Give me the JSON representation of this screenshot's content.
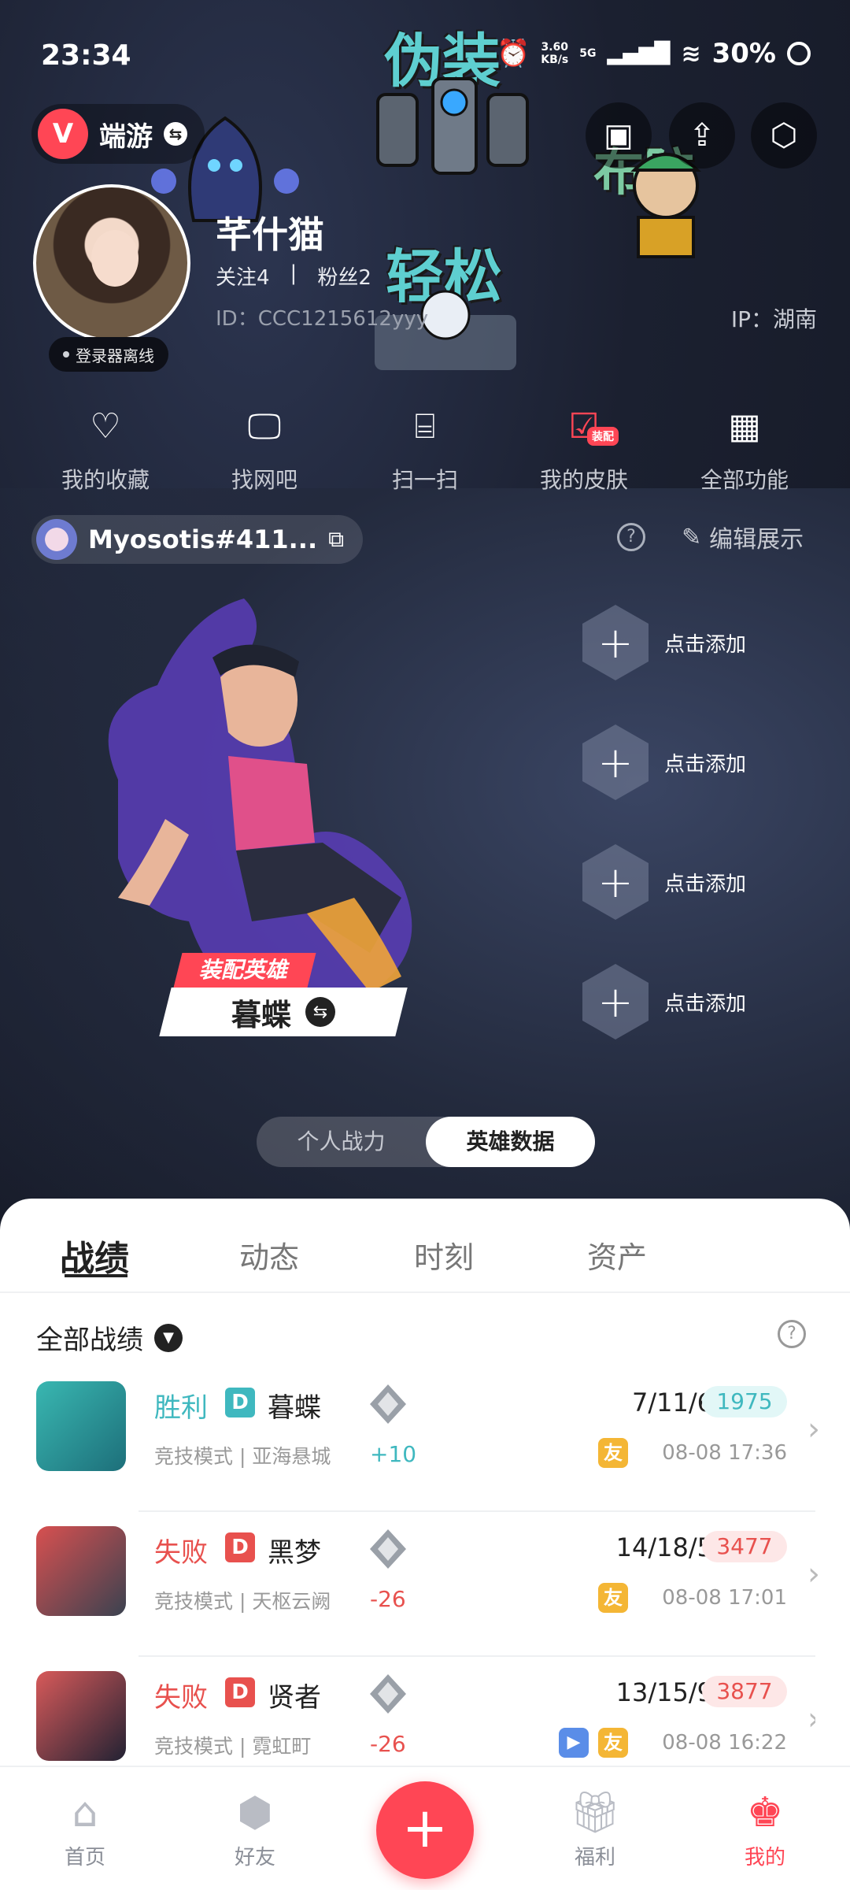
{
  "status_bar": {
    "time": "23:34",
    "net_speed_value": "3.60",
    "net_speed_unit": "KB/s",
    "network": "5G",
    "battery": "30%"
  },
  "stickers": {
    "top_text": "伪装",
    "middle_text": "轻松",
    "right_text": "布防"
  },
  "header": {
    "brand_name": "端游",
    "brand_logo_letter": "V"
  },
  "profile": {
    "username": "芊什猫",
    "follow": "关注4",
    "separator": "|",
    "fans": "粉丝2",
    "id": "ID：CCC1215612yyy",
    "ip": "IP：湖南",
    "status": "登录器离线"
  },
  "quick_actions": [
    {
      "label": "我的收藏",
      "icon": "heart-icon"
    },
    {
      "label": "找网吧",
      "icon": "monitor-icon"
    },
    {
      "label": "扫一扫",
      "icon": "scan-icon"
    },
    {
      "label": "我的皮肤",
      "icon": "skin-icon",
      "badge": "装配"
    },
    {
      "label": "全部功能",
      "icon": "grid-icon"
    }
  ],
  "player": {
    "name": "Myosotis#411...",
    "edit_label": "编辑展示"
  },
  "hero": {
    "equip_tag": "装配英雄",
    "name": "暮蝶"
  },
  "add_slots": [
    "点击添加",
    "点击添加",
    "点击添加",
    "点击添加"
  ],
  "toggle": {
    "left": "个人战力",
    "right": "英雄数据",
    "active": "right"
  },
  "tabs": [
    "战绩",
    "动态",
    "时刻",
    "资产"
  ],
  "records_header": "全部战绩",
  "records": [
    {
      "result": "胜利",
      "outcome": "win",
      "rank": "D",
      "agent": "暮蝶",
      "mode": "竞技模式 | 亚海悬城",
      "delta": "+10",
      "kda": "7/11/6",
      "score": "1975",
      "time": "08-08 17:36",
      "friend": "友",
      "video": false
    },
    {
      "result": "失败",
      "outcome": "lose",
      "rank": "D",
      "agent": "黑梦",
      "mode": "竞技模式 | 天枢云阙",
      "delta": "-26",
      "kda": "14/18/5",
      "score": "3477",
      "time": "08-08 17:01",
      "friend": "友",
      "video": false
    },
    {
      "result": "失败",
      "outcome": "lose",
      "rank": "D",
      "agent": "贤者",
      "mode": "竞技模式 | 霓虹町",
      "delta": "-26",
      "kda": "13/15/9",
      "score": "3877",
      "time": "08-08 16:22",
      "friend": "友",
      "video": true
    }
  ],
  "bottom_nav": [
    {
      "label": "首页",
      "icon": "home-icon"
    },
    {
      "label": "好友",
      "icon": "friends-icon"
    },
    {
      "label": "福利",
      "icon": "gift-icon"
    },
    {
      "label": "我的",
      "icon": "profile-icon",
      "active": true
    }
  ],
  "colors": {
    "accent": "#ff4655",
    "win": "#3fb8bf",
    "lose": "#e8514e",
    "friend_badge": "#f4b635",
    "video_badge": "#5a8de8"
  }
}
